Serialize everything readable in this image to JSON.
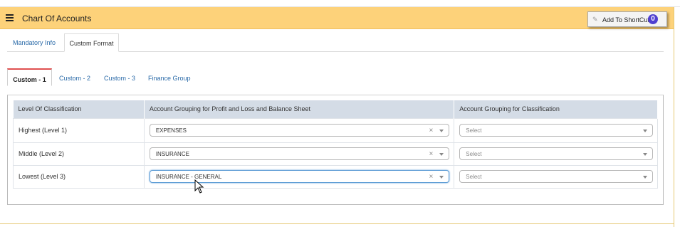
{
  "header": {
    "title": "Chart Of Accounts",
    "shortcut_label": "Add To ShortCut",
    "shortcut_badge": "0"
  },
  "main_tabs": [
    {
      "label": "Mandatory Info",
      "active": false
    },
    {
      "label": "Custom Format",
      "active": true
    }
  ],
  "sub_tabs": [
    {
      "label": "Custom - 1",
      "active": true
    },
    {
      "label": "Custom - 2",
      "active": false
    },
    {
      "label": "Custom - 3",
      "active": false
    },
    {
      "label": "Finance Group",
      "active": false
    }
  ],
  "table": {
    "columns": [
      "Level Of Classification",
      "Account Grouping for Profit and Loss and Balance Sheet",
      "Account Grouping for Classification"
    ],
    "rows": [
      {
        "level": "Highest (Level 1)",
        "grouping": "EXPENSES",
        "classification": "Select"
      },
      {
        "level": "Middle (Level 2)",
        "grouping": "INSURANCE",
        "classification": "Select"
      },
      {
        "level": "Lowest (Level 3)",
        "grouping": "INSURANCE - GENERAL",
        "classification": "Select"
      }
    ]
  },
  "icons": {
    "menu": "hamburger-icon",
    "shortcut": "pin-icon",
    "clear": "clear-x-icon",
    "dropdown": "chevron-down-icon",
    "cursor": "mouse-pointer-icon"
  },
  "colors": {
    "header_bg": "#fdd27a",
    "link": "#2a6aa8",
    "active_tab_accent": "#e05050",
    "table_header_bg": "#d4dce6",
    "badge": "#5040d0"
  }
}
